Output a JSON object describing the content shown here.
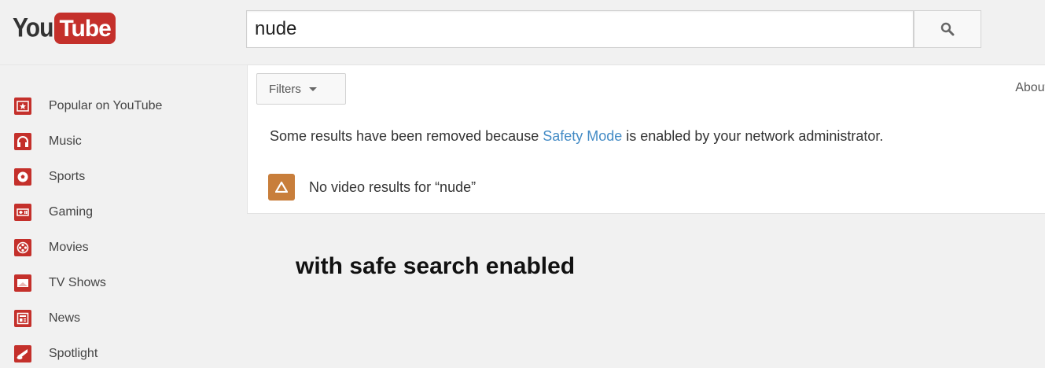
{
  "logo": {
    "part1": "You",
    "part2": "Tube"
  },
  "search": {
    "query": "nude"
  },
  "sidebar": {
    "items": [
      {
        "label": "Popular on YouTube",
        "icon": "star-icon"
      },
      {
        "label": "Music",
        "icon": "headphones-icon"
      },
      {
        "label": "Sports",
        "icon": "soccer-ball-icon"
      },
      {
        "label": "Gaming",
        "icon": "gamepad-icon"
      },
      {
        "label": "Movies",
        "icon": "film-reel-icon"
      },
      {
        "label": "TV Shows",
        "icon": "tv-icon"
      },
      {
        "label": "News",
        "icon": "newspaper-icon"
      },
      {
        "label": "Spotlight",
        "icon": "spotlight-icon"
      }
    ]
  },
  "results": {
    "filters_label": "Filters",
    "about_label": "About",
    "notice_before": "Some results have been removed because ",
    "notice_link": "Safety Mode",
    "notice_after": " is enabled by your network administrator.",
    "no_results": "No video results for “nude”"
  },
  "caption": "with safe search enabled",
  "colors": {
    "brand_red": "#c4302b",
    "link_blue": "#438bc5",
    "warning_orange": "#c87e3b"
  }
}
